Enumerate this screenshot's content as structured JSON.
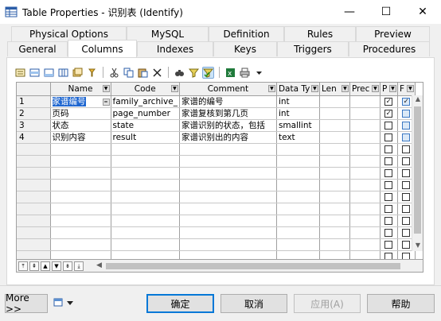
{
  "window": {
    "title": "Table Properties - 识别表 (Identify)",
    "minimize": "—",
    "maximize": "☐",
    "close": "✕"
  },
  "tabs": {
    "row1": [
      "Physical Options",
      "MySQL",
      "Definition",
      "Rules",
      "Preview"
    ],
    "row2": [
      "General",
      "Columns",
      "Indexes",
      "Keys",
      "Triggers",
      "Procedures"
    ],
    "active": "Columns"
  },
  "columns": {
    "headers": [
      "Name",
      "Code",
      "Comment",
      "Data Ty",
      "Len",
      "Prec",
      "P",
      "F"
    ],
    "rows": [
      {
        "num": "1",
        "name": "家谱编号",
        "code": "family_archive_",
        "comment": "家谱的编号",
        "type": "int",
        "len": "",
        "prec": "",
        "p": true,
        "f": true
      },
      {
        "num": "2",
        "name": "页码",
        "code": "page_number",
        "comment": "家谱复核到第几页",
        "type": "int",
        "len": "",
        "prec": "",
        "p": true,
        "f": false
      },
      {
        "num": "3",
        "name": "状态",
        "code": "state",
        "comment": "家谱识别的状态，包括",
        "type": "smallint",
        "len": "",
        "prec": "",
        "p": false,
        "f": false
      },
      {
        "num": "4",
        "name": "识别内容",
        "code": "result",
        "comment": "家谱识别出的内容",
        "type": "text",
        "len": "",
        "prec": "",
        "p": false,
        "f": false
      }
    ],
    "empty_rows": 12
  },
  "footer": {
    "more": "More >>",
    "ok": "确定",
    "cancel": "取消",
    "apply": "应用(A)",
    "help": "帮助"
  },
  "colors": {
    "selection": "#1e66d0",
    "accent": "#0078d7"
  }
}
